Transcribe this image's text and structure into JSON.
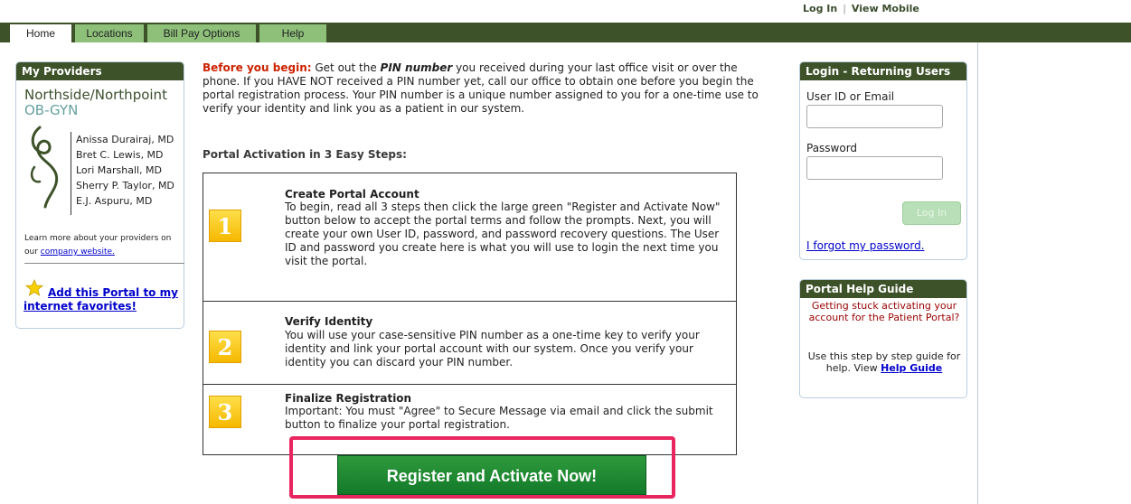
{
  "top_links": {
    "login": "Log In",
    "sep": "|",
    "view_mobile": "View Mobile"
  },
  "nav": {
    "tabs": [
      {
        "label": "Home",
        "active": true
      },
      {
        "label": "Locations"
      },
      {
        "label": "Bill Pay Options"
      },
      {
        "label": "Help"
      }
    ]
  },
  "providers": {
    "title": "My Providers",
    "practice_name": "Northside/Northpoint",
    "practice_sub": "OB-GYN",
    "doctors": [
      "Anissa Durairaj, MD",
      "Bret C. Lewis, MD",
      "Lori Marshall, MD",
      "Sherry P. Taylor, MD",
      "E.J. Aspuru, MD"
    ],
    "learn_prefix": "Learn more about your providers on our",
    "learn_link": "company website.",
    "favorites_link": "Add this Portal to my internet favorites!"
  },
  "intro": {
    "lead": "Before you begin:",
    "text1": " Get out the ",
    "pin": "PIN number",
    "text2": " you received during your last office visit or over the phone.  If you HAVE NOT received a PIN number yet, call our office to obtain one before you begin the portal registration process.  Your PIN number is a unique number assigned to you for a one-time use to verify your identity and link you as a patient in our system."
  },
  "steps_title": "Portal Activation in 3 Easy Steps:",
  "steps": [
    {
      "num": "1",
      "title": "Create Portal Account",
      "body": "To begin, read all 3 steps then click the large green \"Register and Activate Now\" button below to accept the portal terms and follow the prompts.  Next, you will create your own User ID, password, and password recovery questions.  The User ID and password you create here is what you will use to login the next time you visit the portal."
    },
    {
      "num": "2",
      "title": "Verify Identity",
      "body": "You will use your case-sensitive PIN number as a one-time key to verify your identity and link your portal account with our system.  Once you verify your identity you can discard your PIN number."
    },
    {
      "num": "3",
      "title": "Finalize Registration",
      "body": "Important:  You must \"Agree\" to Secure Message via email and click the submit button to finalize your portal registration."
    }
  ],
  "register_button": "Register and Activate Now!",
  "login": {
    "title": "Login - Returning Users",
    "user_label": "User ID or Email",
    "user_value": "",
    "password_label": "Password",
    "password_value": "",
    "button": "Log In",
    "forgot": "I forgot my password."
  },
  "help_guide": {
    "title": "Portal Help Guide",
    "red_text": "Getting stuck activating your account for the Patient Portal?",
    "body_prefix": "Use this step by step guide for help. View ",
    "link": "Help Guide"
  }
}
